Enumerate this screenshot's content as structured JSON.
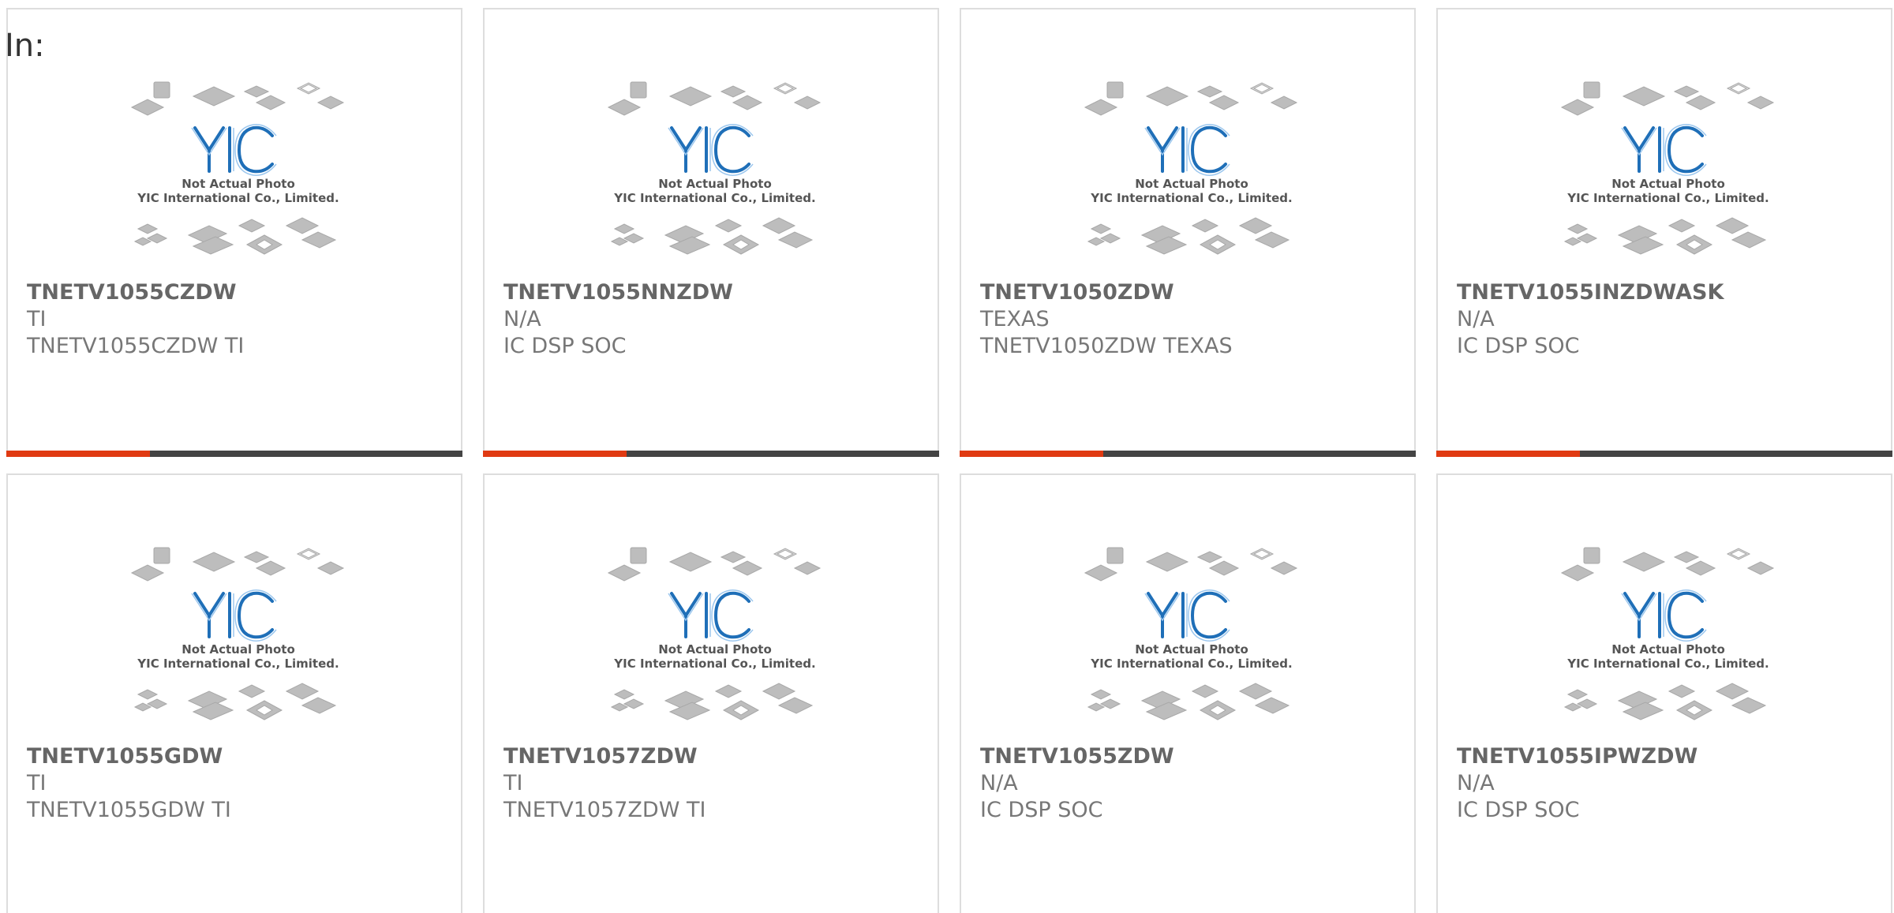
{
  "page": {
    "label": "In:"
  },
  "placeholder_image": {
    "brand": "YIC",
    "caption_line1": "Not Actual Photo",
    "caption_line2": "YIC International Co., Limited."
  },
  "colors": {
    "accent": "#e03a12",
    "bar_dark": "#444444",
    "logo_blue": "#1f6fb8",
    "chip_gray": "#b9b9b9"
  },
  "products": [
    {
      "title": "TNETV1055CZDW",
      "line1": "TI",
      "line2": "TNETV1055CZDW TI"
    },
    {
      "title": "TNETV1055NNZDW",
      "line1": "N/A",
      "line2": "IC DSP SOC"
    },
    {
      "title": "TNETV1050ZDW",
      "line1": "TEXAS",
      "line2": "TNETV1050ZDW TEXAS"
    },
    {
      "title": "TNETV1055INZDWASK",
      "line1": "N/A",
      "line2": "IC DSP SOC"
    },
    {
      "title": "TNETV1055GDW",
      "line1": "TI",
      "line2": "TNETV1055GDW TI"
    },
    {
      "title": "TNETV1057ZDW",
      "line1": "TI",
      "line2": "TNETV1057ZDW TI"
    },
    {
      "title": "TNETV1055ZDW",
      "line1": "N/A",
      "line2": "IC DSP SOC"
    },
    {
      "title": "TNETV1055IPWZDW",
      "line1": "N/A",
      "line2": "IC DSP SOC"
    }
  ]
}
